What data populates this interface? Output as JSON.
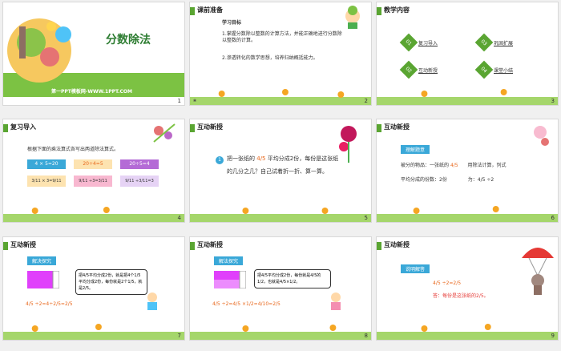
{
  "slides": [
    {
      "number": "1",
      "title": "分数除法",
      "footer": "第一PPT模板网-WWW.1PPT.COM"
    },
    {
      "number": "2",
      "header": "课前准备",
      "subheader": "学习目标",
      "points": [
        "1.掌握分数除以整数的计算方法，并能正确地进行分数除以整数的计算。",
        "2.渗透转化的数学思想，培养归纳概括能力。"
      ]
    },
    {
      "number": "3",
      "header": "教学内容",
      "items": [
        {
          "num": "01",
          "label": "复习导入"
        },
        {
          "num": "02",
          "label": "互动新授"
        },
        {
          "num": "03",
          "label": "巩固扩展"
        },
        {
          "num": "04",
          "label": "课堂小结"
        }
      ]
    },
    {
      "number": "4",
      "header": "复习导入",
      "prompt": "根据下面的乘法算式各写出两道除法算式。",
      "eq1": "4 × 5=20",
      "eq2": "20÷4=5",
      "eq3": "20÷5=4",
      "eq4": "3/11 × 3=9/11",
      "eq5": "9/11 ÷3=3/11",
      "eq6": "9/11 ÷3/11=3"
    },
    {
      "number": "5",
      "header": "互动新授",
      "badge": "1",
      "question_a": "把一张纸的",
      "question_frac": "4/5",
      "question_b": "平均分成2份，每份是这张纸",
      "question_c": "的几分之几？自己试着折一折、算一算。"
    },
    {
      "number": "6",
      "header": "互动新授",
      "tag": "理解题意",
      "line1_a": "被分的物品：一张纸的",
      "line1_frac": "4/5",
      "line1_b": "用除法计算，列式",
      "line2_a": "平均分成的份数：2份",
      "line2_b": "为：4/5 ÷2"
    },
    {
      "number": "7",
      "header": "互动新授",
      "tag": "解决探究",
      "bubble1": "把4/5平均分成2份，就是把4个1/5平均分成2份，每份就是2个1/5，就是2/5。",
      "formula": "4/5 ÷2=4÷2/5=2/5"
    },
    {
      "number": "8",
      "header": "互动新授",
      "tag": "解法探究",
      "bubble1": "把4/5平均分成2份，每份就是4/5的1/2，也就是4/5×1/2。",
      "formula": "4/5 ÷2=4/5 ×1/2=4/10=2/5"
    },
    {
      "number": "9",
      "header": "互动新授",
      "tag": "说明解答",
      "formula": "4/5 ÷2=2/5",
      "answer": "答：每份是这张纸的2/5。"
    }
  ],
  "colors": {
    "green": "#5aa532",
    "orange": "#e8661a",
    "purple": "#b46bd6",
    "teal": "#3aa8d8"
  }
}
